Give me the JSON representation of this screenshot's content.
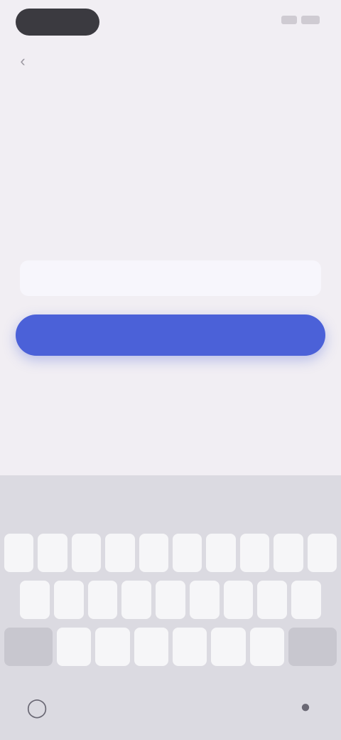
{
  "status_bar": {
    "signal_icon": "signal-icon",
    "battery_icon": "battery-icon"
  },
  "topbar": {
    "back_icon": "back-arrow-icon",
    "title": ""
  },
  "content": {
    "heading": "",
    "subheading": ""
  },
  "form": {
    "input_value": "",
    "input_placeholder": "",
    "primary_button_label": ""
  },
  "keyboard": {
    "suggestions": [
      "",
      "",
      "",
      "",
      "",
      "",
      "",
      "",
      ""
    ],
    "row1": [
      "",
      "",
      "",
      "",
      "",
      "",
      "",
      "",
      "",
      ""
    ],
    "row2": [
      "",
      "",
      "",
      "",
      "",
      "",
      "",
      "",
      ""
    ],
    "row3": [
      "",
      "",
      "",
      "",
      "",
      "",
      "",
      ""
    ],
    "row4": {
      "mode": "",
      "emoji": "",
      "space": "",
      "period": "",
      "return": ""
    },
    "globe_icon": "globe-icon",
    "mic_icon": "microphone-icon"
  },
  "colors": {
    "background": "#f1eef3",
    "accent": "#4b61d8",
    "keyboard_bg": "#dbdae1"
  }
}
